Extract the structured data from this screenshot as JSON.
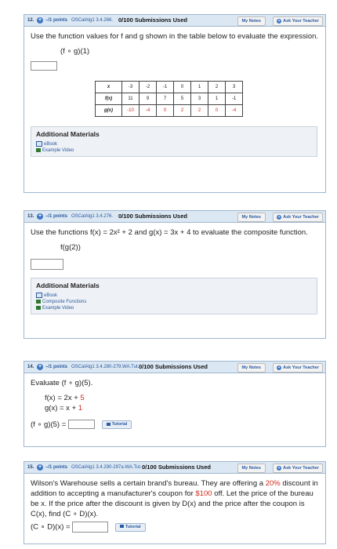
{
  "q12": {
    "num": "12.",
    "points": "–/1 points",
    "code": "OSCalAlg1 3.4.266.",
    "submissions": "0/100 Submissions Used",
    "my_notes": "My Notes",
    "ask_teacher": "Ask Your Teacher",
    "text": "Use the function values for f and g shown in the table below to evaluate the expression.",
    "expression": "(f ∘ g)(1)",
    "table": {
      "x_label": "x",
      "f_label": "f(x)",
      "g_label": "g(x)",
      "x": [
        "-3",
        "-2",
        "-1",
        "0",
        "1",
        "2",
        "3"
      ],
      "f": [
        "11",
        "9",
        "7",
        "5",
        "3",
        "1",
        "-1"
      ],
      "g": [
        "-10",
        "-4",
        "0",
        "2",
        "2",
        "0",
        "-4"
      ]
    },
    "add_materials": "Additional Materials",
    "materials": [
      "eBook",
      "Example Video"
    ]
  },
  "q13": {
    "num": "13.",
    "points": "–/1 points",
    "code": "OSCalAlg1 3.4.276.",
    "submissions": "0/100 Submissions Used",
    "my_notes": "My Notes",
    "ask_teacher": "Ask Your Teacher",
    "text_a": "Use the functions ",
    "f_def": "f(x) = 2x² + 2",
    "and": " and ",
    "g_def": "g(x) = 3x + 4",
    "text_b": " to evaluate the composite function.",
    "expression": "f(g(2))",
    "add_materials": "Additional Materials",
    "materials": [
      "eBook",
      "Composite Functions",
      "Example Video"
    ]
  },
  "q14": {
    "num": "14.",
    "points": "–/1 points",
    "code": "OSCalAlg1 3.4.280-279.WA.Tut.",
    "submissions": "0/100 Submissions Used",
    "my_notes": "My Notes",
    "ask_teacher": "Ask Your Teacher",
    "prompt": "Evaluate",
    "expr": "(f ∘ g)(5).",
    "f_line_a": "f(x) = 2x + ",
    "f_line_red": "5",
    "g_line_a": "g(x) = x + ",
    "g_line_red": "1",
    "answer_label": "(f ∘ g)(5) =",
    "tutorial": "Tutorial"
  },
  "q15": {
    "num": "15.",
    "points": "–/1 points",
    "code": "OSCalAlg1 3.4.290-297a.WA.Tut.",
    "submissions": "0/100 Submissions Used",
    "my_notes": "My Notes",
    "ask_teacher": "Ask Your Teacher",
    "t1": "Wilson's Warehouse sells a certain brand's bureau. They are offering a ",
    "pct": "20%",
    "t2": " discount in addition to accepting a manufacturer's coupon for ",
    "amt": "$100",
    "t3": " off. Let the price of the bureau be x. If the price after the discount is given by D(x) and the price after the coupon is C(x), find (C ∘ D)(x).",
    "answer_label": "(C ∘ D)(x) =",
    "tutorial": "Tutorial"
  }
}
